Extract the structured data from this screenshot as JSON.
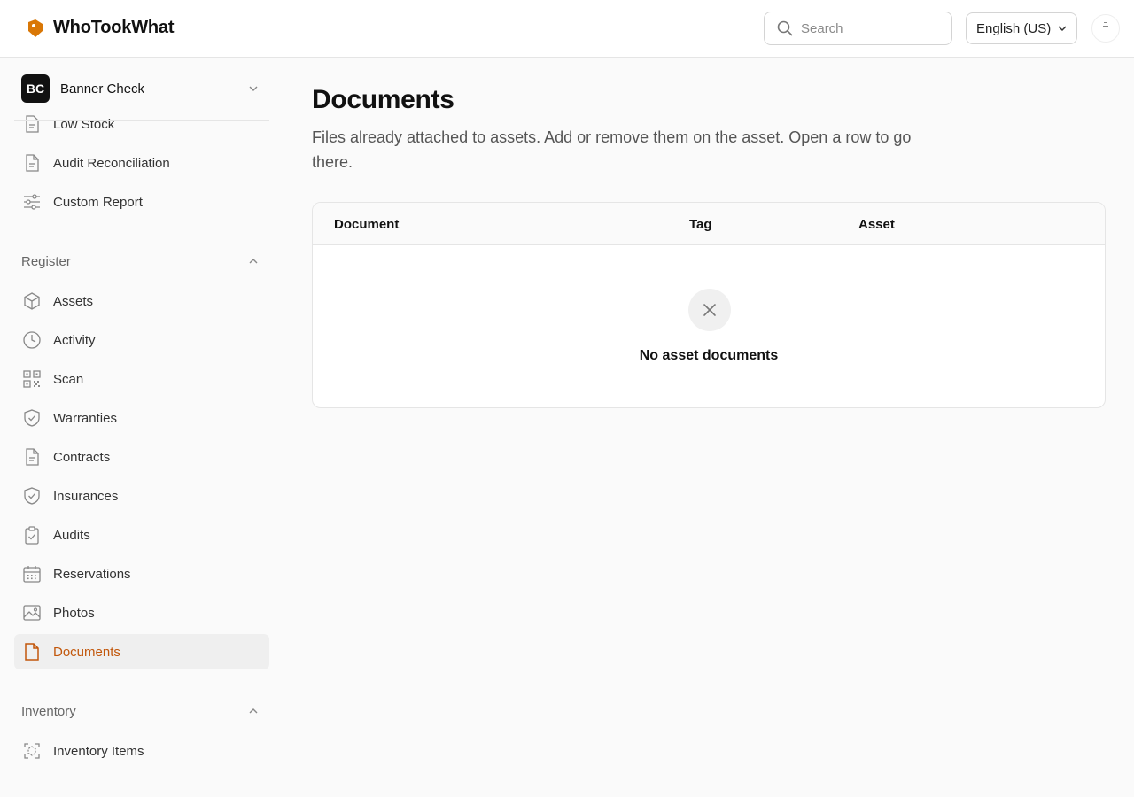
{
  "app": {
    "name": "WhoTookWhat",
    "brand_color": "#d97706"
  },
  "header": {
    "search_placeholder": "Search",
    "language": "English (US)"
  },
  "sidebar": {
    "workspace": {
      "initials": "BC",
      "name": "Banner Check"
    },
    "report_items": [
      {
        "label": "Low Stock",
        "icon": "document-icon"
      },
      {
        "label": "Audit Reconciliation",
        "icon": "document-icon"
      },
      {
        "label": "Custom Report",
        "icon": "sliders-icon"
      }
    ],
    "register": {
      "title": "Register",
      "items": [
        {
          "label": "Assets",
          "icon": "cube-icon"
        },
        {
          "label": "Activity",
          "icon": "clock-icon"
        },
        {
          "label": "Scan",
          "icon": "qr-code-icon"
        },
        {
          "label": "Warranties",
          "icon": "shield-check-icon"
        },
        {
          "label": "Contracts",
          "icon": "document-icon"
        },
        {
          "label": "Insurances",
          "icon": "shield-check-icon"
        },
        {
          "label": "Audits",
          "icon": "clipboard-check-icon"
        },
        {
          "label": "Reservations",
          "icon": "calendar-icon"
        },
        {
          "label": "Photos",
          "icon": "image-icon"
        },
        {
          "label": "Documents",
          "icon": "file-icon",
          "active": true
        }
      ]
    },
    "inventory": {
      "title": "Inventory",
      "items": [
        {
          "label": "Inventory Items",
          "icon": "scan-box-icon"
        }
      ]
    },
    "active_color": "#c2570b"
  },
  "main": {
    "title": "Documents",
    "subtitle": "Files already attached to assets. Add or remove them on the asset. Open a row to go there.",
    "table": {
      "columns": [
        "Document",
        "Tag",
        "Asset"
      ],
      "empty_text": "No asset documents"
    }
  }
}
